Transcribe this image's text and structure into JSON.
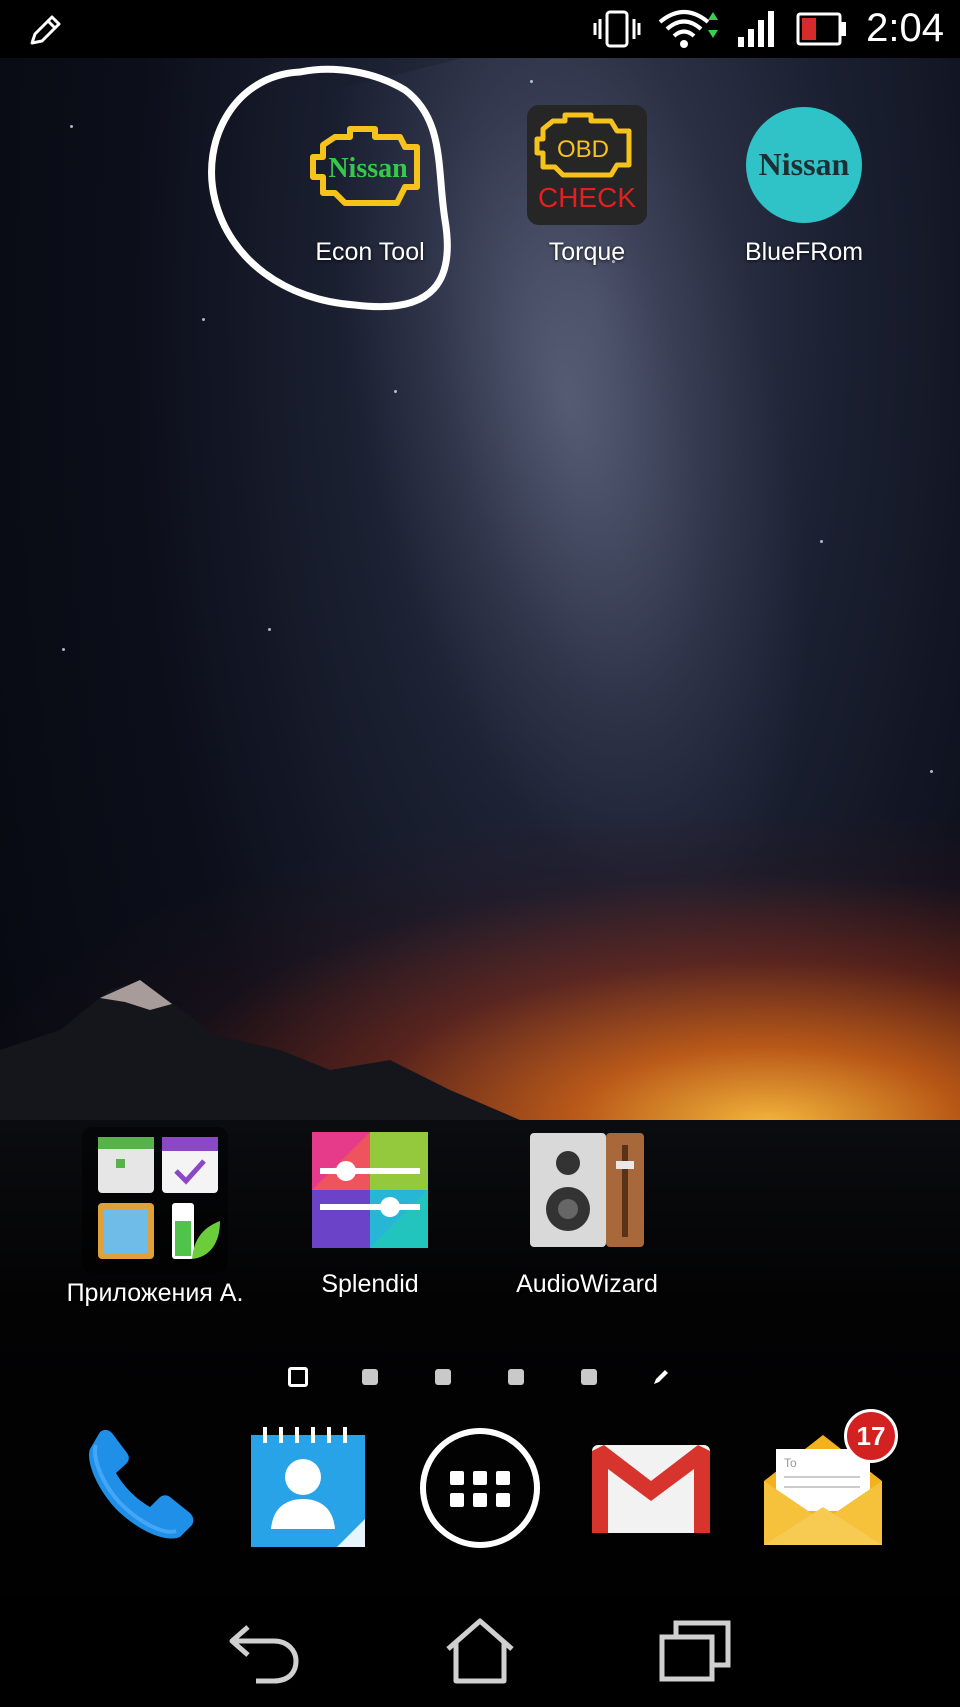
{
  "status_bar": {
    "time": "2:04",
    "icons": [
      "edit-icon",
      "vibrate-icon",
      "wifi-icon",
      "signal-icon",
      "battery-icon"
    ]
  },
  "home_apps_top": [
    {
      "name": "Econ Tool",
      "icon": "check-engine-nissan-icon",
      "icon_text": "Nissan",
      "highlighted": true
    },
    {
      "name": "Torque",
      "icon": "obd-check-icon",
      "icon_text_1": "OBD",
      "icon_text_2": "CHECK"
    },
    {
      "name": "BlueFRom",
      "icon": "nissan-circle-icon",
      "icon_text": "Nissan"
    }
  ],
  "home_apps_bottom": [
    {
      "name": "Приложения А.",
      "icon": "app-folder-icon"
    },
    {
      "name": "Splendid",
      "icon": "splendid-icon"
    },
    {
      "name": "AudioWizard",
      "icon": "audio-speaker-icon"
    }
  ],
  "page_indicator": {
    "pages": 5,
    "current": 1,
    "extra": "edit-page-icon"
  },
  "dock": {
    "items": [
      "phone-icon",
      "contacts-icon",
      "app-drawer-icon",
      "gmail-icon",
      "email-icon"
    ],
    "email_badge": "17",
    "email_to": "To"
  },
  "navbar": [
    "back-icon",
    "home-icon",
    "recents-icon"
  ],
  "colors": {
    "accent_yellow": "#f6c21c",
    "badge_red": "#d32121",
    "nissan_teal": "#2fc2c6"
  }
}
